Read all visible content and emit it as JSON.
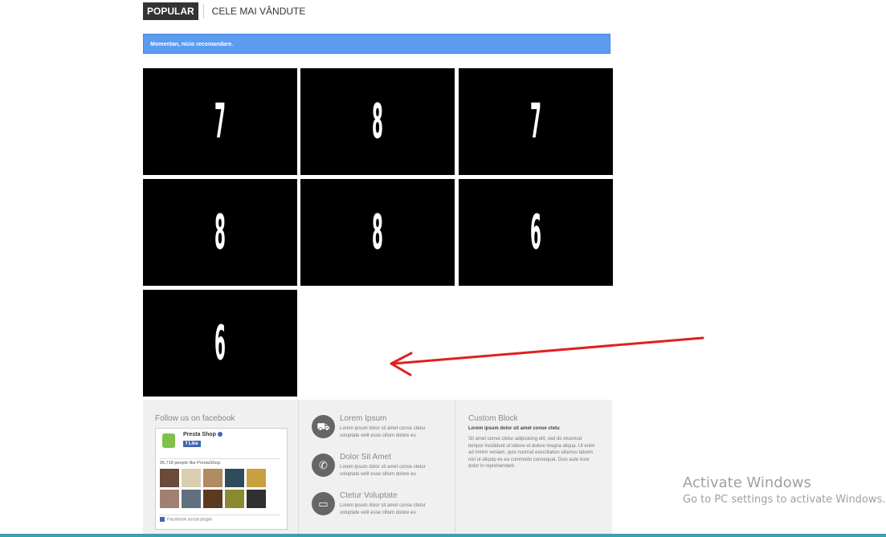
{
  "tabs": {
    "active": "POPULAR",
    "other": "CELE MAI VÂNDUTE"
  },
  "alert": {
    "text": "Momentan, nicio recomandare."
  },
  "tiles": [
    "7",
    "8",
    "7",
    "8",
    "8",
    "6",
    "6"
  ],
  "footer": {
    "facebook": {
      "title": "Follow us on facebook",
      "page_name": "Presta Shop",
      "like_label": "Like",
      "count_text": "95,718 people like PrestaShop.",
      "plugin_text": "Facebook social plugin"
    },
    "features": [
      {
        "icon": "truck-icon",
        "glyph": "⛟",
        "title": "Lorem Ipsum",
        "text": "Lorem ipsum dolor sit amet conse ctetur voluptate velit esse cillum dolore eu"
      },
      {
        "icon": "phone-icon",
        "glyph": "✆",
        "title": "Dolor Sit Amet",
        "text": "Lorem ipsum dolor sit amet conse ctetur voluptate velit esse cillum dolore eu"
      },
      {
        "icon": "credit-card-icon",
        "glyph": "▭",
        "title": "Ctetur Voluptate",
        "text": "Lorem ipsum dolor sit amet conse ctetur voluptate velit esse cillum dolore eu"
      }
    ],
    "custom_block": {
      "title": "Custom Block",
      "subtitle": "Lorem ipsum dolor sit amet conse ctetu",
      "text": "Sit amet conse ctetur adipisicing elit, sed do eiusmod tempor incididunt ut labore et dolore magna aliqua. Ut enim ad minim veniam, quis nostrud exercitation ullamco laboris nisi ut aliquip ex ea commodo consequat. Duis aute irure dolor in reprehenderit"
    }
  },
  "watermark": {
    "line1": "Activate Windows",
    "line2": "Go to PC settings to activate Windows."
  },
  "colors": {
    "alert_bg": "#5b9bf0",
    "tile_bg": "#000000",
    "arrow": "#e02020",
    "footer_bg": "#f0f0f0"
  }
}
